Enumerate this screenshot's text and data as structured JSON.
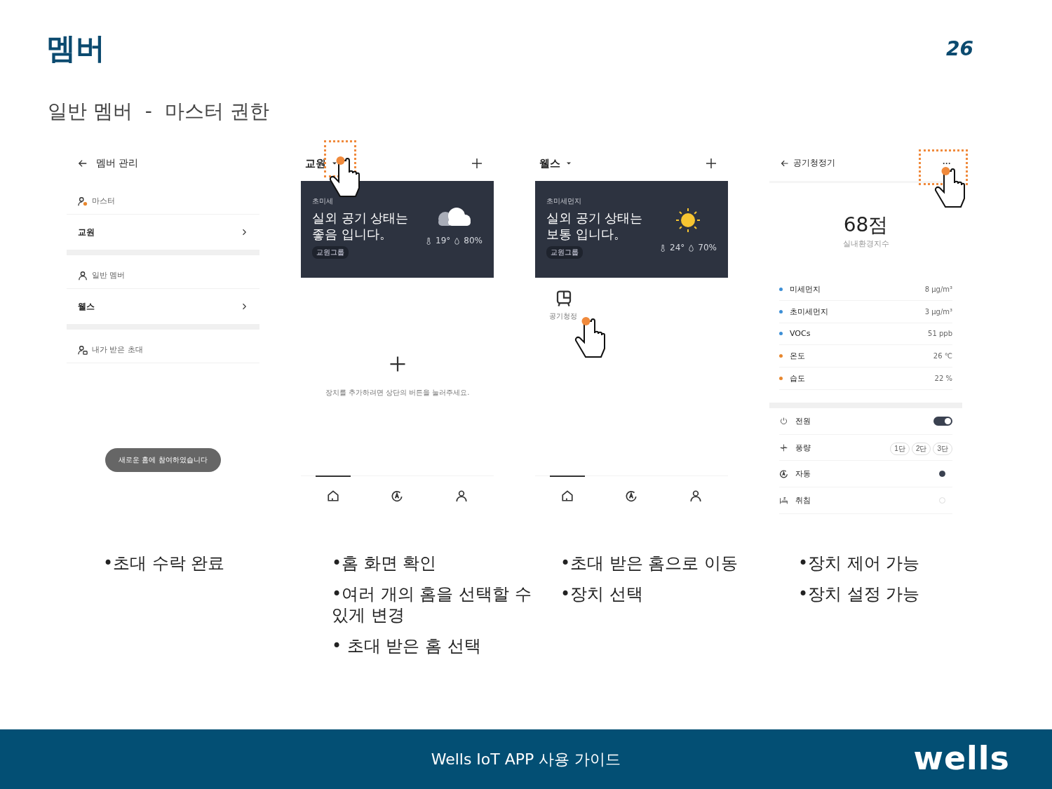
{
  "title": "멤버",
  "page_number": "26",
  "subtitle": "일반 멤버  -  마스터 권한",
  "screens": [
    {
      "kind": "members",
      "header": "멤버 관리",
      "sections": [
        {
          "kind": "master",
          "label": "마스터",
          "items": [
            "교원"
          ]
        },
        {
          "kind": "member",
          "label": "일반 멤버",
          "items": [
            "웰스"
          ]
        },
        {
          "kind": "invite",
          "label": "내가 받은 초대"
        }
      ],
      "toast": "새로운 홈에 참여하였습니다"
    },
    {
      "kind": "home",
      "home_name": "교원",
      "highlighted": true,
      "dust_label": "초미세",
      "message": "실외 공기 상태는\n좋음 입니다。",
      "group": "교원그룹",
      "weather": {
        "kind": "cloud",
        "temperature": "19°",
        "humidity": "80%"
      },
      "empty_message": "장치를 추가하려면 상단의 버튼을 눌러주세요.",
      "nav": [
        {
          "kind": "home",
          "selected": true
        },
        {
          "kind": "auto",
          "selected": false
        },
        {
          "kind": "person",
          "selected": false
        }
      ]
    },
    {
      "kind": "home",
      "home_name": "웰스",
      "highlighted": false,
      "dust_label": "초미세먼지",
      "message": "실외 공기 상태는\n보통 입니다。",
      "group": "교원그룹",
      "weather": {
        "kind": "sun",
        "temperature": "24°",
        "humidity": "70%"
      },
      "devices": [
        {
          "label": "공기청정",
          "tapped": true
        }
      ],
      "nav": [
        {
          "kind": "home",
          "selected": true
        },
        {
          "kind": "auto",
          "selected": false
        },
        {
          "kind": "person",
          "selected": false
        }
      ]
    },
    {
      "kind": "device",
      "header": "공기청정기",
      "menu": "···",
      "highlighted": true,
      "score": "68점",
      "score_label": "실내환경지수",
      "readings": [
        {
          "label": "미세먼지",
          "value": "8 μg/m³",
          "color": "#3d8fd6"
        },
        {
          "label": "초미세먼지",
          "value": "3 μg/m³",
          "color": "#3d8fd6"
        },
        {
          "label": "VOCs",
          "value": "51 ppb",
          "color": "#3d8fd6"
        },
        {
          "label": "온도",
          "value": "26 ℃",
          "color": "#e8872e"
        },
        {
          "label": "습도",
          "value": "22 %",
          "color": "#e8872e"
        }
      ],
      "controls": [
        {
          "kind": "toggle",
          "label": "전원",
          "on": true
        },
        {
          "kind": "levels",
          "label": "풍량",
          "options": [
            {
              "label": "1단",
              "selected": false
            },
            {
              "label": "2단",
              "selected": false
            },
            {
              "label": "3단",
              "selected": false
            }
          ]
        },
        {
          "kind": "radio",
          "label": "자동",
          "selected": true
        },
        {
          "kind": "radio",
          "label": "취침",
          "selected": false
        }
      ]
    }
  ],
  "notes": [
    [
      "•초대 수락 완료"
    ],
    [
      "•홈 화면 확인",
      "•여러 개의 홈을 선택할 수 있게 변경",
      "•  초대 받은 홈 선택"
    ],
    [
      "•초대 받은 홈으로 이동",
      "•장치 선택"
    ],
    [
      "•장치 제어 가능",
      "•장치 설정 가능"
    ]
  ],
  "footer": {
    "text": "Wells IoT APP 사용 가이드",
    "logo": "wells"
  }
}
